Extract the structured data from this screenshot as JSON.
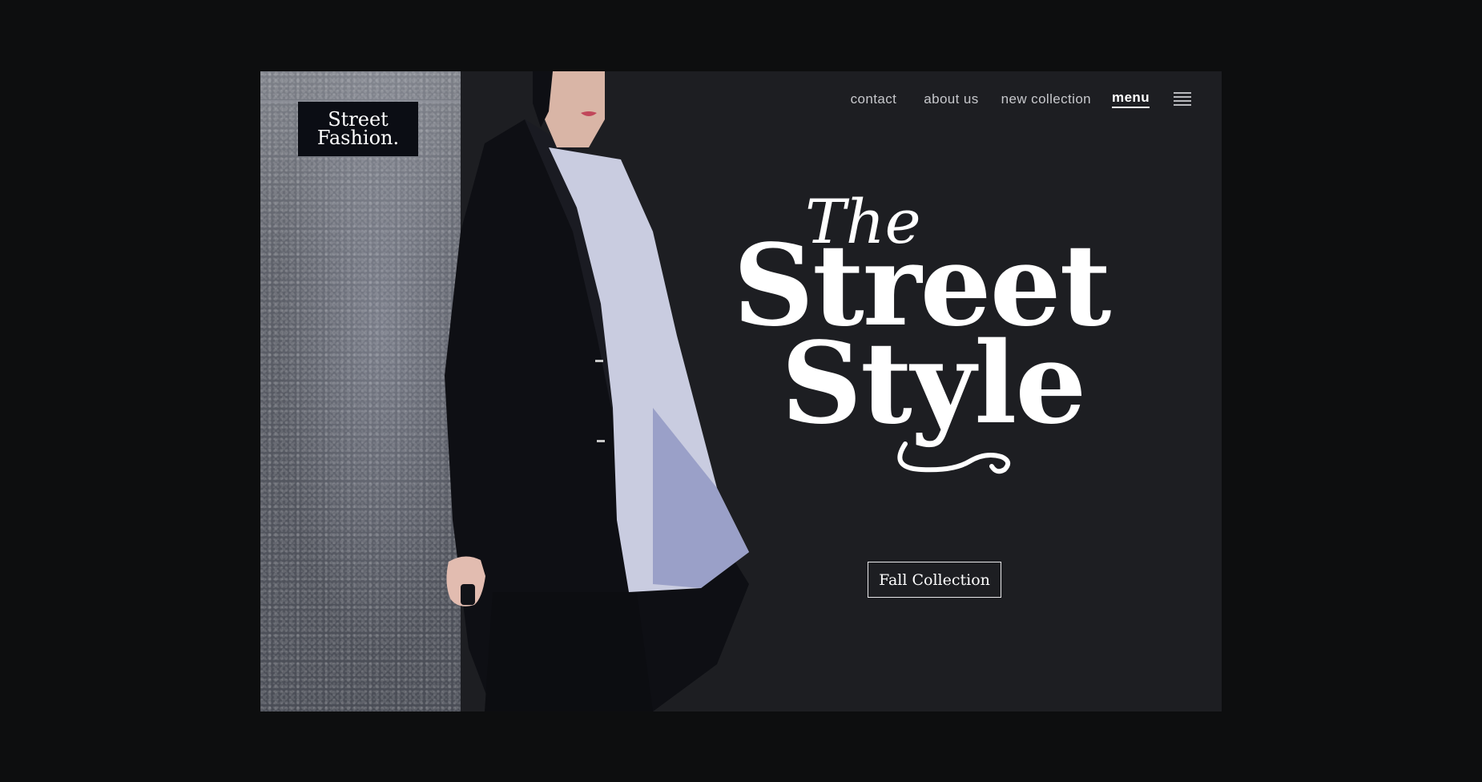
{
  "logo": {
    "line1": "Street",
    "line2": "Fashion."
  },
  "nav": {
    "items": [
      {
        "label": "contact"
      },
      {
        "label": "about us"
      },
      {
        "label": "new collection"
      },
      {
        "label": "menu"
      }
    ],
    "menu_icon": "hamburger-icon"
  },
  "hero": {
    "the": "The",
    "street": "Street",
    "style": "Style",
    "cta_label": "Fall Collection",
    "image": "model-in-black-blazer-photo"
  },
  "colors": {
    "background": "#0d0e0f",
    "panel": "#1d1e22",
    "text": "#ffffff",
    "nav_text": "#c7c8cc",
    "logo_bg": "#0b0d14"
  }
}
